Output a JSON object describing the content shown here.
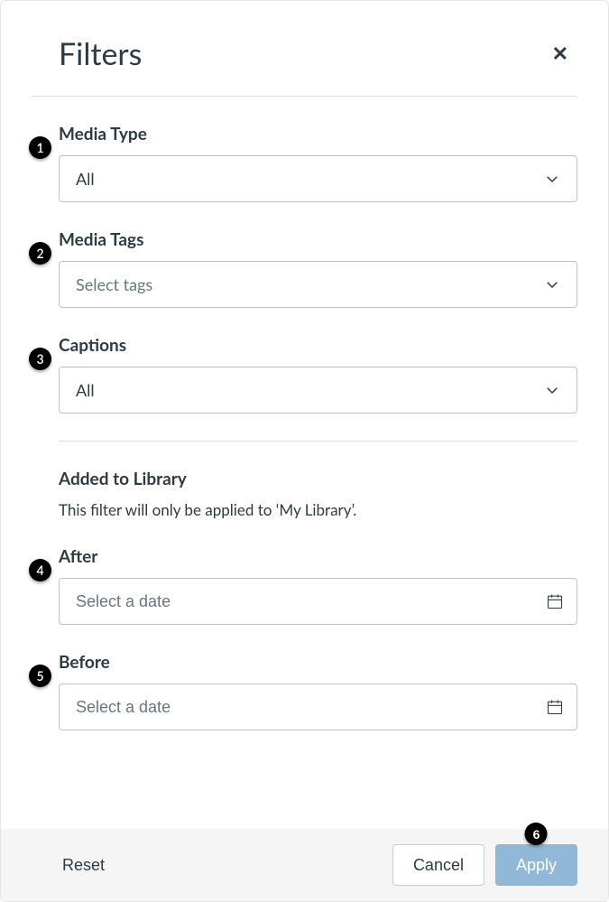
{
  "header": {
    "title": "Filters"
  },
  "fields": {
    "media_type": {
      "label": "Media Type",
      "value": "All"
    },
    "media_tags": {
      "label": "Media Tags",
      "placeholder": "Select tags"
    },
    "captions": {
      "label": "Captions",
      "value": "All"
    },
    "added_section": {
      "heading": "Added to Library",
      "description": "This filter will only be applied to ‘My Library’."
    },
    "after": {
      "label": "After",
      "placeholder": "Select a date"
    },
    "before": {
      "label": "Before",
      "placeholder": "Select a date"
    }
  },
  "footer": {
    "reset": "Reset",
    "cancel": "Cancel",
    "apply": "Apply"
  },
  "markers": {
    "m1": "1",
    "m2": "2",
    "m3": "3",
    "m4": "4",
    "m5": "5",
    "m6": "6"
  }
}
